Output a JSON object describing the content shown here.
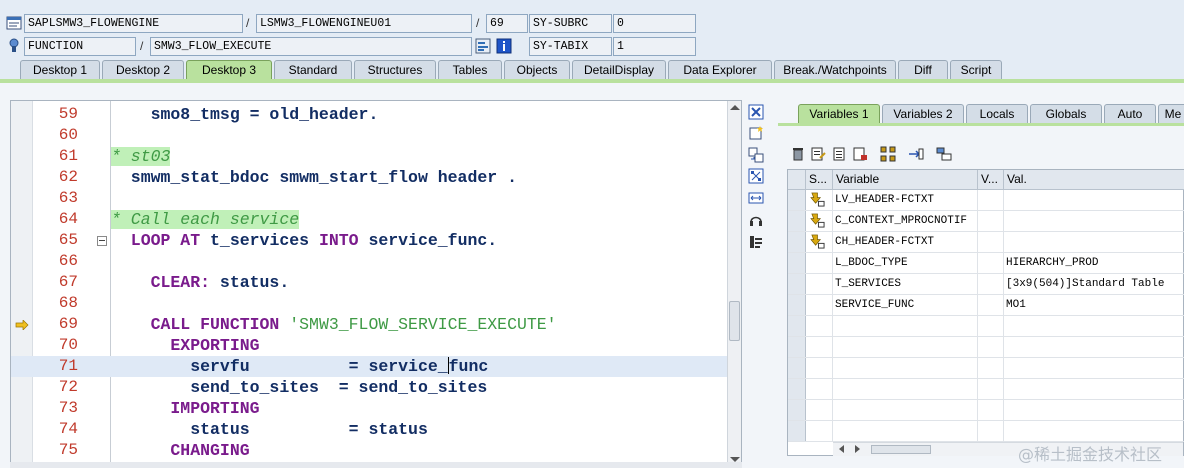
{
  "header": {
    "program": "SAPLSMW3_FLOWENGINE",
    "include": "LSMW3_FLOWENGINEU01",
    "line": "69",
    "subrc_label": "SY-SUBRC",
    "subrc_value": "0",
    "event_type": "FUNCTION",
    "event_name": "SMW3_FLOW_EXECUTE",
    "tabix_label": "SY-TABIX",
    "tabix_value": "1",
    "sep": "/"
  },
  "tabs": [
    "Desktop 1",
    "Desktop 2",
    "Desktop 3",
    "Standard",
    "Structures",
    "Tables",
    "Objects",
    "DetailDisplay",
    "Data Explorer",
    "Break./Watchpoints",
    "Diff",
    "Script"
  ],
  "active_tab": "Desktop 3",
  "code": {
    "lines": [
      {
        "num": "59",
        "segs": [
          {
            "t": "    smo8_tmsg = old_header.",
            "c": "i"
          }
        ]
      },
      {
        "num": "60",
        "segs": []
      },
      {
        "num": "61",
        "segs": [
          {
            "t": "* st03",
            "c": "cm"
          }
        ]
      },
      {
        "num": "62",
        "segs": [
          {
            "t": "  smwm_stat_bdoc smwm_start_flow header .",
            "c": "i"
          }
        ]
      },
      {
        "num": "63",
        "segs": []
      },
      {
        "num": "64",
        "segs": [
          {
            "t": "* Call each service",
            "c": "cm"
          }
        ]
      },
      {
        "num": "65",
        "segs": [
          {
            "t": "  LOOP AT ",
            "c": "k"
          },
          {
            "t": "t_services ",
            "c": "i"
          },
          {
            "t": "INTO ",
            "c": "k"
          },
          {
            "t": "service_func.",
            "c": "i"
          }
        ]
      },
      {
        "num": "66",
        "segs": []
      },
      {
        "num": "67",
        "segs": [
          {
            "t": "    CLEAR: ",
            "c": "k"
          },
          {
            "t": "status.",
            "c": "i"
          }
        ]
      },
      {
        "num": "68",
        "segs": []
      },
      {
        "num": "69",
        "segs": [
          {
            "t": "    CALL FUNCTION ",
            "c": "k"
          },
          {
            "t": "'SMW3_FLOW_SERVICE_EXECUTE'",
            "c": "s"
          }
        ]
      },
      {
        "num": "70",
        "segs": [
          {
            "t": "      EXPORTING",
            "c": "k"
          }
        ]
      },
      {
        "num": "71",
        "segs": [
          {
            "t": "        servfu          = service_",
            "c": "i"
          },
          {
            "t": "",
            "c": "caret"
          },
          {
            "t": "func",
            "c": "i"
          }
        ]
      },
      {
        "num": "72",
        "segs": [
          {
            "t": "        send_to_sites  = send_to_sites",
            "c": "i"
          }
        ]
      },
      {
        "num": "73",
        "segs": [
          {
            "t": "      IMPORTING",
            "c": "k"
          }
        ]
      },
      {
        "num": "74",
        "segs": [
          {
            "t": "        status          = status",
            "c": "i"
          }
        ]
      },
      {
        "num": "75",
        "segs": [
          {
            "t": "      CHANGING",
            "c": "k"
          }
        ]
      }
    ]
  },
  "vars_tabs": [
    "Variables 1",
    "Variables 2",
    "Locals",
    "Globals",
    "Auto",
    "Me"
  ],
  "vars_active_tab": "Variables 1",
  "vars_columns": {
    "s": "S...",
    "variable": "Variable",
    "v": "V...",
    "value": "Val."
  },
  "vars_rows": [
    {
      "name": "LV_HEADER-FCTXT",
      "value": "",
      "icon": true
    },
    {
      "name": "C_CONTEXT_MPROCNOTIF",
      "value": "",
      "icon": true
    },
    {
      "name": "CH_HEADER-FCTXT",
      "value": "",
      "icon": true
    },
    {
      "name": "L_BDOC_TYPE",
      "value": "HIERARCHY_PROD",
      "icon": false
    },
    {
      "name": "T_SERVICES",
      "value": "[3x9(504)]Standard Table",
      "icon": false
    },
    {
      "name": "SERVICE_FUNC",
      "value": "MO1",
      "icon": false
    },
    {
      "name": "",
      "value": "",
      "icon": false
    },
    {
      "name": "",
      "value": "",
      "icon": false
    },
    {
      "name": "",
      "value": "",
      "icon": false
    },
    {
      "name": "",
      "value": "",
      "icon": false
    },
    {
      "name": "",
      "value": "",
      "icon": false
    },
    {
      "name": "",
      "value": "",
      "icon": false
    }
  ],
  "watermark": "@稀土掘金技术社区",
  "colors": {
    "keyword": "#7a1b8c",
    "identifier": "#122d63",
    "string": "#3f9a45",
    "line_number": "#c03a2b",
    "active_tab": "#b9e19e"
  }
}
